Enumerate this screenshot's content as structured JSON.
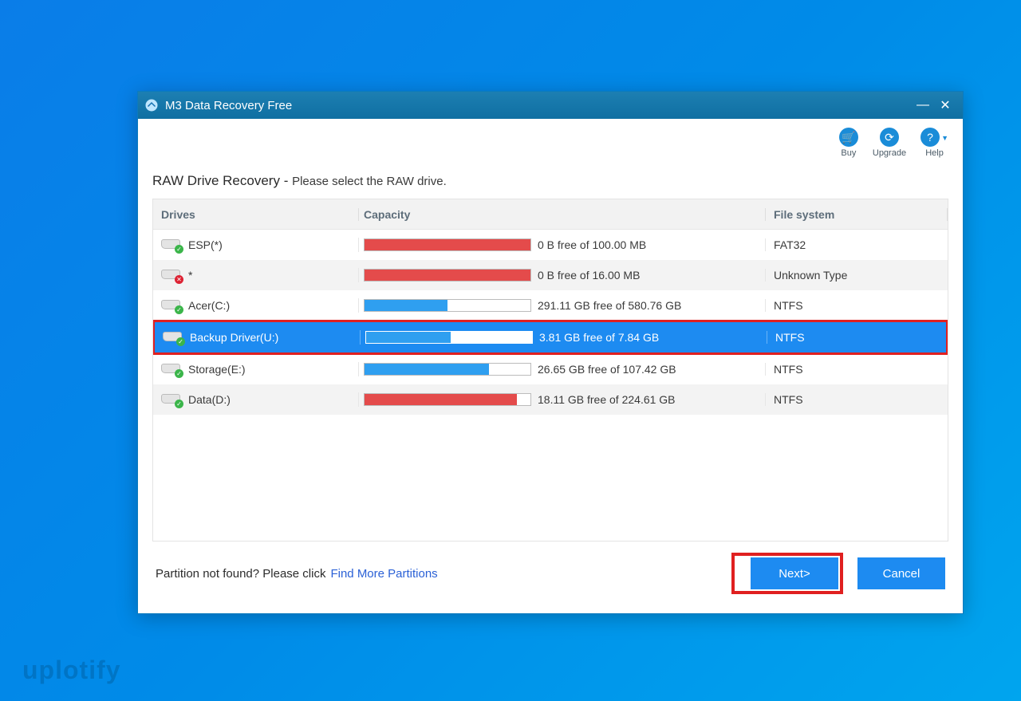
{
  "window": {
    "title": "M3 Data Recovery Free"
  },
  "toolbar": {
    "buy": {
      "label": "Buy"
    },
    "upgrade": {
      "label": "Upgrade"
    },
    "help": {
      "label": "Help"
    }
  },
  "heading": {
    "main": "RAW Drive Recovery",
    "sub": "Please select the RAW drive."
  },
  "columns": {
    "drive": "Drives",
    "capacity": "Capacity",
    "filesystem": "File system"
  },
  "drives": [
    {
      "name": "ESP(*)",
      "free": "0 B",
      "total": "100.00 MB",
      "fs": "FAT32",
      "pct": 100,
      "color": "red",
      "badge": "ok",
      "alt": false,
      "selected": false
    },
    {
      "name": "*",
      "free": "0 B",
      "total": "16.00 MB",
      "fs": "Unknown Type",
      "pct": 100,
      "color": "red",
      "badge": "err",
      "alt": true,
      "selected": false
    },
    {
      "name": "Acer(C:)",
      "free": "291.11 GB",
      "total": "580.76 GB",
      "fs": "NTFS",
      "pct": 50,
      "color": "blue",
      "badge": "ok",
      "alt": false,
      "selected": false
    },
    {
      "name": "Backup Driver(U:)",
      "free": "3.81 GB",
      "total": "7.84 GB",
      "fs": "NTFS",
      "pct": 51,
      "color": "blue",
      "badge": "ok",
      "alt": true,
      "selected": true
    },
    {
      "name": "Storage(E:)",
      "free": "26.65 GB",
      "total": "107.42 GB",
      "fs": "NTFS",
      "pct": 75,
      "color": "blue",
      "badge": "ok",
      "alt": false,
      "selected": false
    },
    {
      "name": "Data(D:)",
      "free": "18.11 GB",
      "total": "224.61 GB",
      "fs": "NTFS",
      "pct": 92,
      "color": "red",
      "badge": "ok",
      "alt": true,
      "selected": false
    }
  ],
  "footer": {
    "prompt": "Partition not found? Please click",
    "link": "Find More Partitions",
    "next": "Next>",
    "cancel": "Cancel"
  },
  "watermark": "uplotify"
}
